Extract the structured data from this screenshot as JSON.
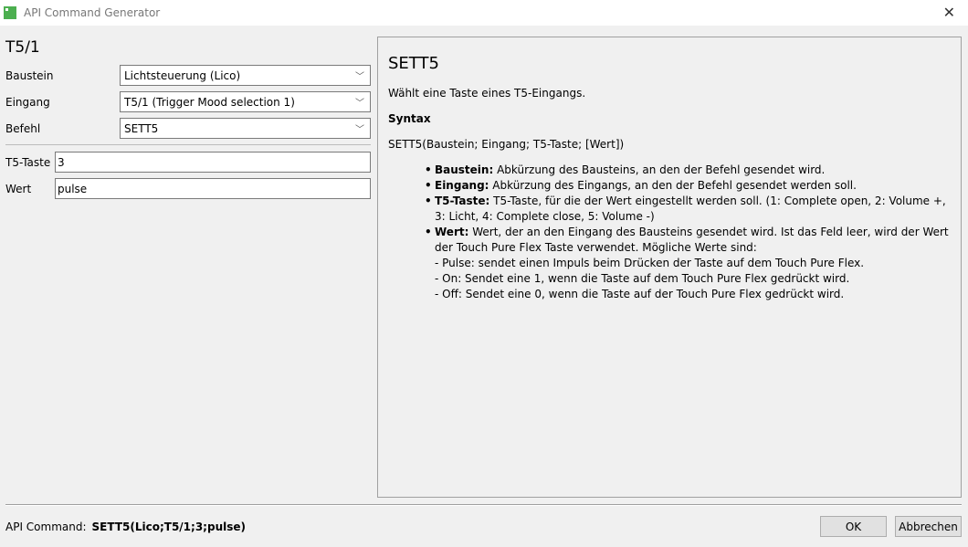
{
  "window": {
    "title": "API Command Generator",
    "close": "✕"
  },
  "left": {
    "heading": "T5/1",
    "fields": [
      {
        "label": "Baustein",
        "value": "Lichtsteuerung (Lico)"
      },
      {
        "label": "Eingang",
        "value": "T5/1 (Trigger Mood selection 1)"
      },
      {
        "label": "Befehl",
        "value": "SETT5"
      }
    ],
    "params": [
      {
        "label": "T5-Taste",
        "value": "3"
      },
      {
        "label": "Wert",
        "value": "pulse"
      }
    ]
  },
  "help": {
    "title": "SETT5",
    "description": "Wählt eine Taste eines T5-Eingangs.",
    "syntax_heading": "Syntax",
    "syntax": "SETT5(Baustein; Eingang; T5-Taste; [Wert])",
    "items": [
      {
        "term": "Baustein:",
        "text": " Abkürzung des Bausteins, an den der Befehl gesendet wird."
      },
      {
        "term": "Eingang:",
        "text": " Abkürzung des Eingangs, an den der Befehl gesendet werden soll."
      },
      {
        "term": "T5-Taste:",
        "text": " T5-Taste, für die der Wert eingestellt werden soll. (1: Complete open, 2: Volume +, 3: Licht, 4: Complete close, 5: Volume -)"
      },
      {
        "term": "Wert:",
        "text": " Wert, der an den Eingang des Bausteins gesendet wird. Ist das Feld leer, wird der Wert der Touch Pure Flex Taste verwendet. Mögliche Werte sind:"
      }
    ],
    "subitems": [
      "- Pulse: sendet einen Impuls beim Drücken der Taste auf dem Touch Pure Flex.",
      "- On: Sendet eine 1, wenn die Taste auf dem Touch Pure Flex gedrückt wird.",
      "- Off: Sendet eine 0, wenn die Taste auf der Touch Pure Flex gedrückt wird."
    ]
  },
  "footer": {
    "api_label": "API Command:",
    "api_value": "SETT5(Lico;T5/1;3;pulse)",
    "ok": "OK",
    "cancel": "Abbrechen"
  }
}
